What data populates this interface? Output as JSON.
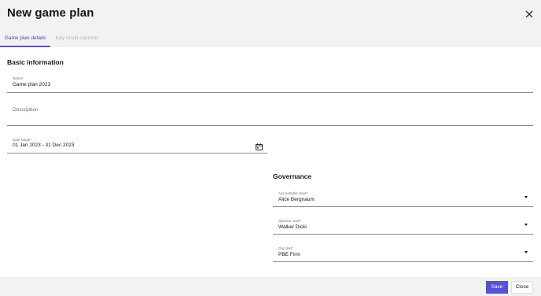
{
  "dialog": {
    "title": "New game plan",
    "close_icon": "close-icon"
  },
  "tabs": [
    {
      "label": "Game plan details",
      "active": true
    },
    {
      "label": "Key result columns",
      "active": false
    }
  ],
  "basic_information": {
    "heading": "Basic information",
    "name": {
      "label": "Name*",
      "value": "Game plan 2023"
    },
    "description": {
      "placeholder": "Description"
    },
    "date_range": {
      "label": "Date range*",
      "value": "01 Jan 2023 - 31 Dec 2023",
      "icon": "calendar-icon"
    }
  },
  "governance": {
    "heading": "Governance",
    "accountable_user": {
      "label": "Accountable User*",
      "value": "Alice Bergnaum",
      "icon": "chevron-down-icon"
    },
    "sponsor_user": {
      "label": "Sponsor User*",
      "value": "Walker Dicki",
      "icon": "chevron-down-icon"
    },
    "org_unit": {
      "label": "Org Unit*",
      "value": "PBE Firm",
      "icon": "chevron-down-icon"
    }
  },
  "footer": {
    "save_label": "Save",
    "close_label": "Close"
  },
  "colors": {
    "accent": "#5551d8",
    "header_bg": "#f2f2f2",
    "field_line": "#8d8d8d"
  }
}
